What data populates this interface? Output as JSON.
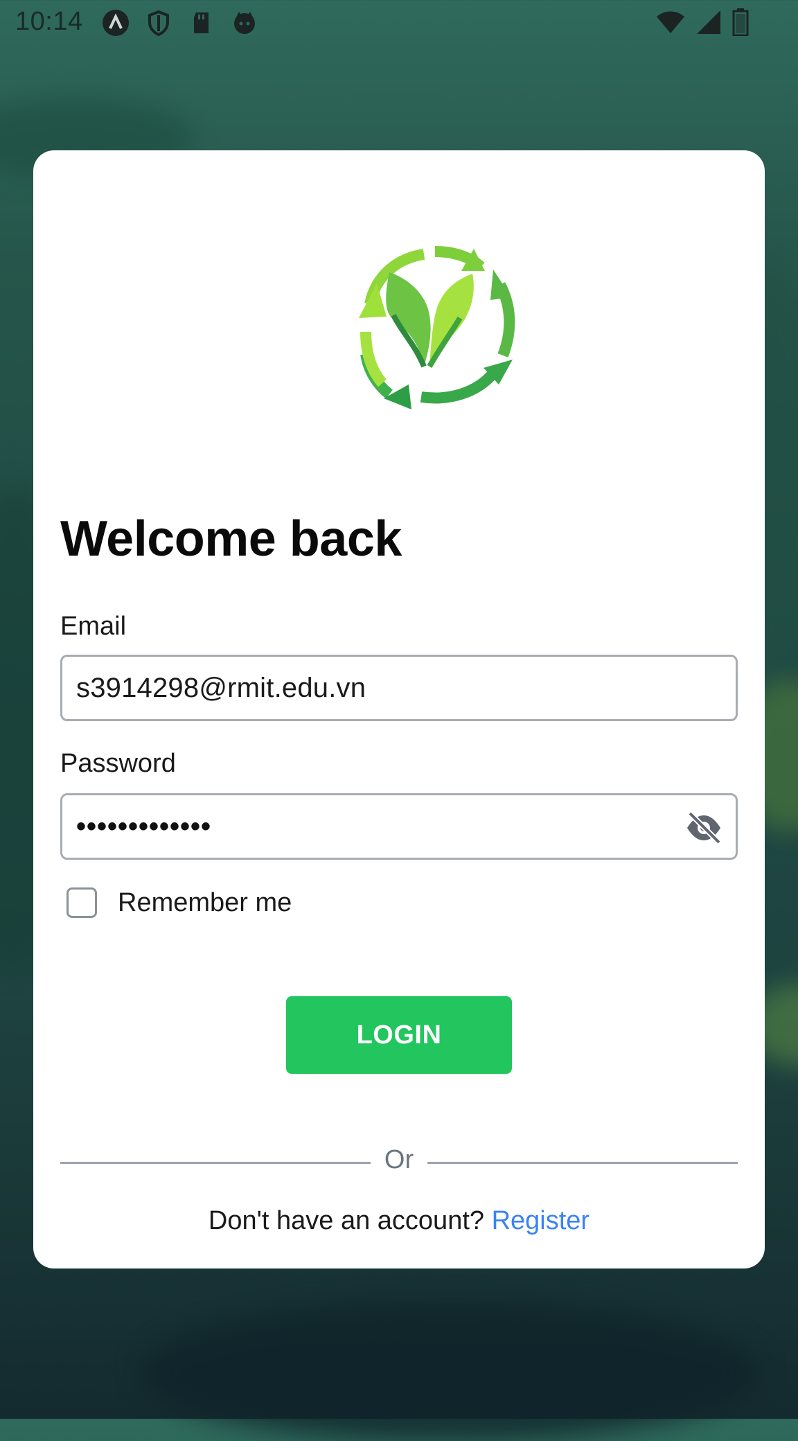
{
  "status_bar": {
    "time": "10:14",
    "left_icons": [
      "app-a-icon",
      "shield-icon",
      "sd-card-icon",
      "cat-icon"
    ],
    "right_icons": [
      "wifi-icon",
      "signal-icon",
      "battery-icon"
    ]
  },
  "login_card": {
    "logo": "recycle-leaf-logo",
    "title": "Welcome back",
    "email": {
      "label": "Email",
      "value": "s3914298@rmit.edu.vn"
    },
    "password": {
      "label": "Password",
      "value_masked": "•••••••••••••",
      "toggle_icon": "eye-off-icon"
    },
    "remember_me": {
      "label": "Remember me",
      "checked": false
    },
    "login_button": "LOGIN",
    "divider_text": "Or",
    "register": {
      "prompt": "Don't have an account?",
      "link": "Register"
    }
  },
  "colors": {
    "primary_button": "#22c55e",
    "link": "#3b82f6",
    "logo_light_green": "#9fe03a",
    "logo_dark_green": "#2e9e46"
  }
}
